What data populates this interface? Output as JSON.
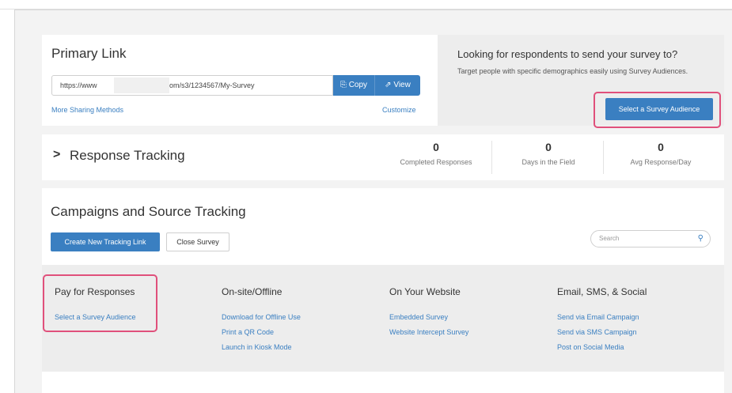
{
  "primary_link": {
    "title": "Primary Link",
    "url_prefix": "https://www",
    "url_suffix": "om/s3/1234567/My-Survey",
    "copy_label": "Copy",
    "view_label": "View",
    "more_sharing": "More Sharing Methods",
    "customize": "Customize"
  },
  "audience": {
    "title": "Looking for respondents to send your survey to?",
    "description": "Target people with specific demographics easily using Survey Audiences.",
    "button": "Select a Survey Audience"
  },
  "response_tracking": {
    "title": "Response Tracking",
    "stats": [
      {
        "value": "0",
        "label": "Completed Responses"
      },
      {
        "value": "0",
        "label": "Days in the Field"
      },
      {
        "value": "0",
        "label": "Avg Response/Day"
      }
    ]
  },
  "campaigns": {
    "title": "Campaigns and Source Tracking",
    "create_button": "Create New Tracking Link",
    "close_button": "Close Survey",
    "search_placeholder": "Search"
  },
  "columns": [
    {
      "title": "Pay for Responses",
      "items": [
        "Select a Survey Audience"
      ]
    },
    {
      "title": "On-site/Offline",
      "items": [
        "Download for Offline Use",
        "Print a QR Code",
        "Launch in Kiosk Mode"
      ]
    },
    {
      "title": "On Your Website",
      "items": [
        "Embedded Survey",
        "Website Intercept Survey"
      ]
    },
    {
      "title": "Email, SMS, & Social",
      "items": [
        "Send via Email Campaign",
        "Send via SMS Campaign",
        "Post on Social Media"
      ]
    }
  ],
  "colors": {
    "accent": "#3a7fc1",
    "highlight": "#e0507b"
  }
}
